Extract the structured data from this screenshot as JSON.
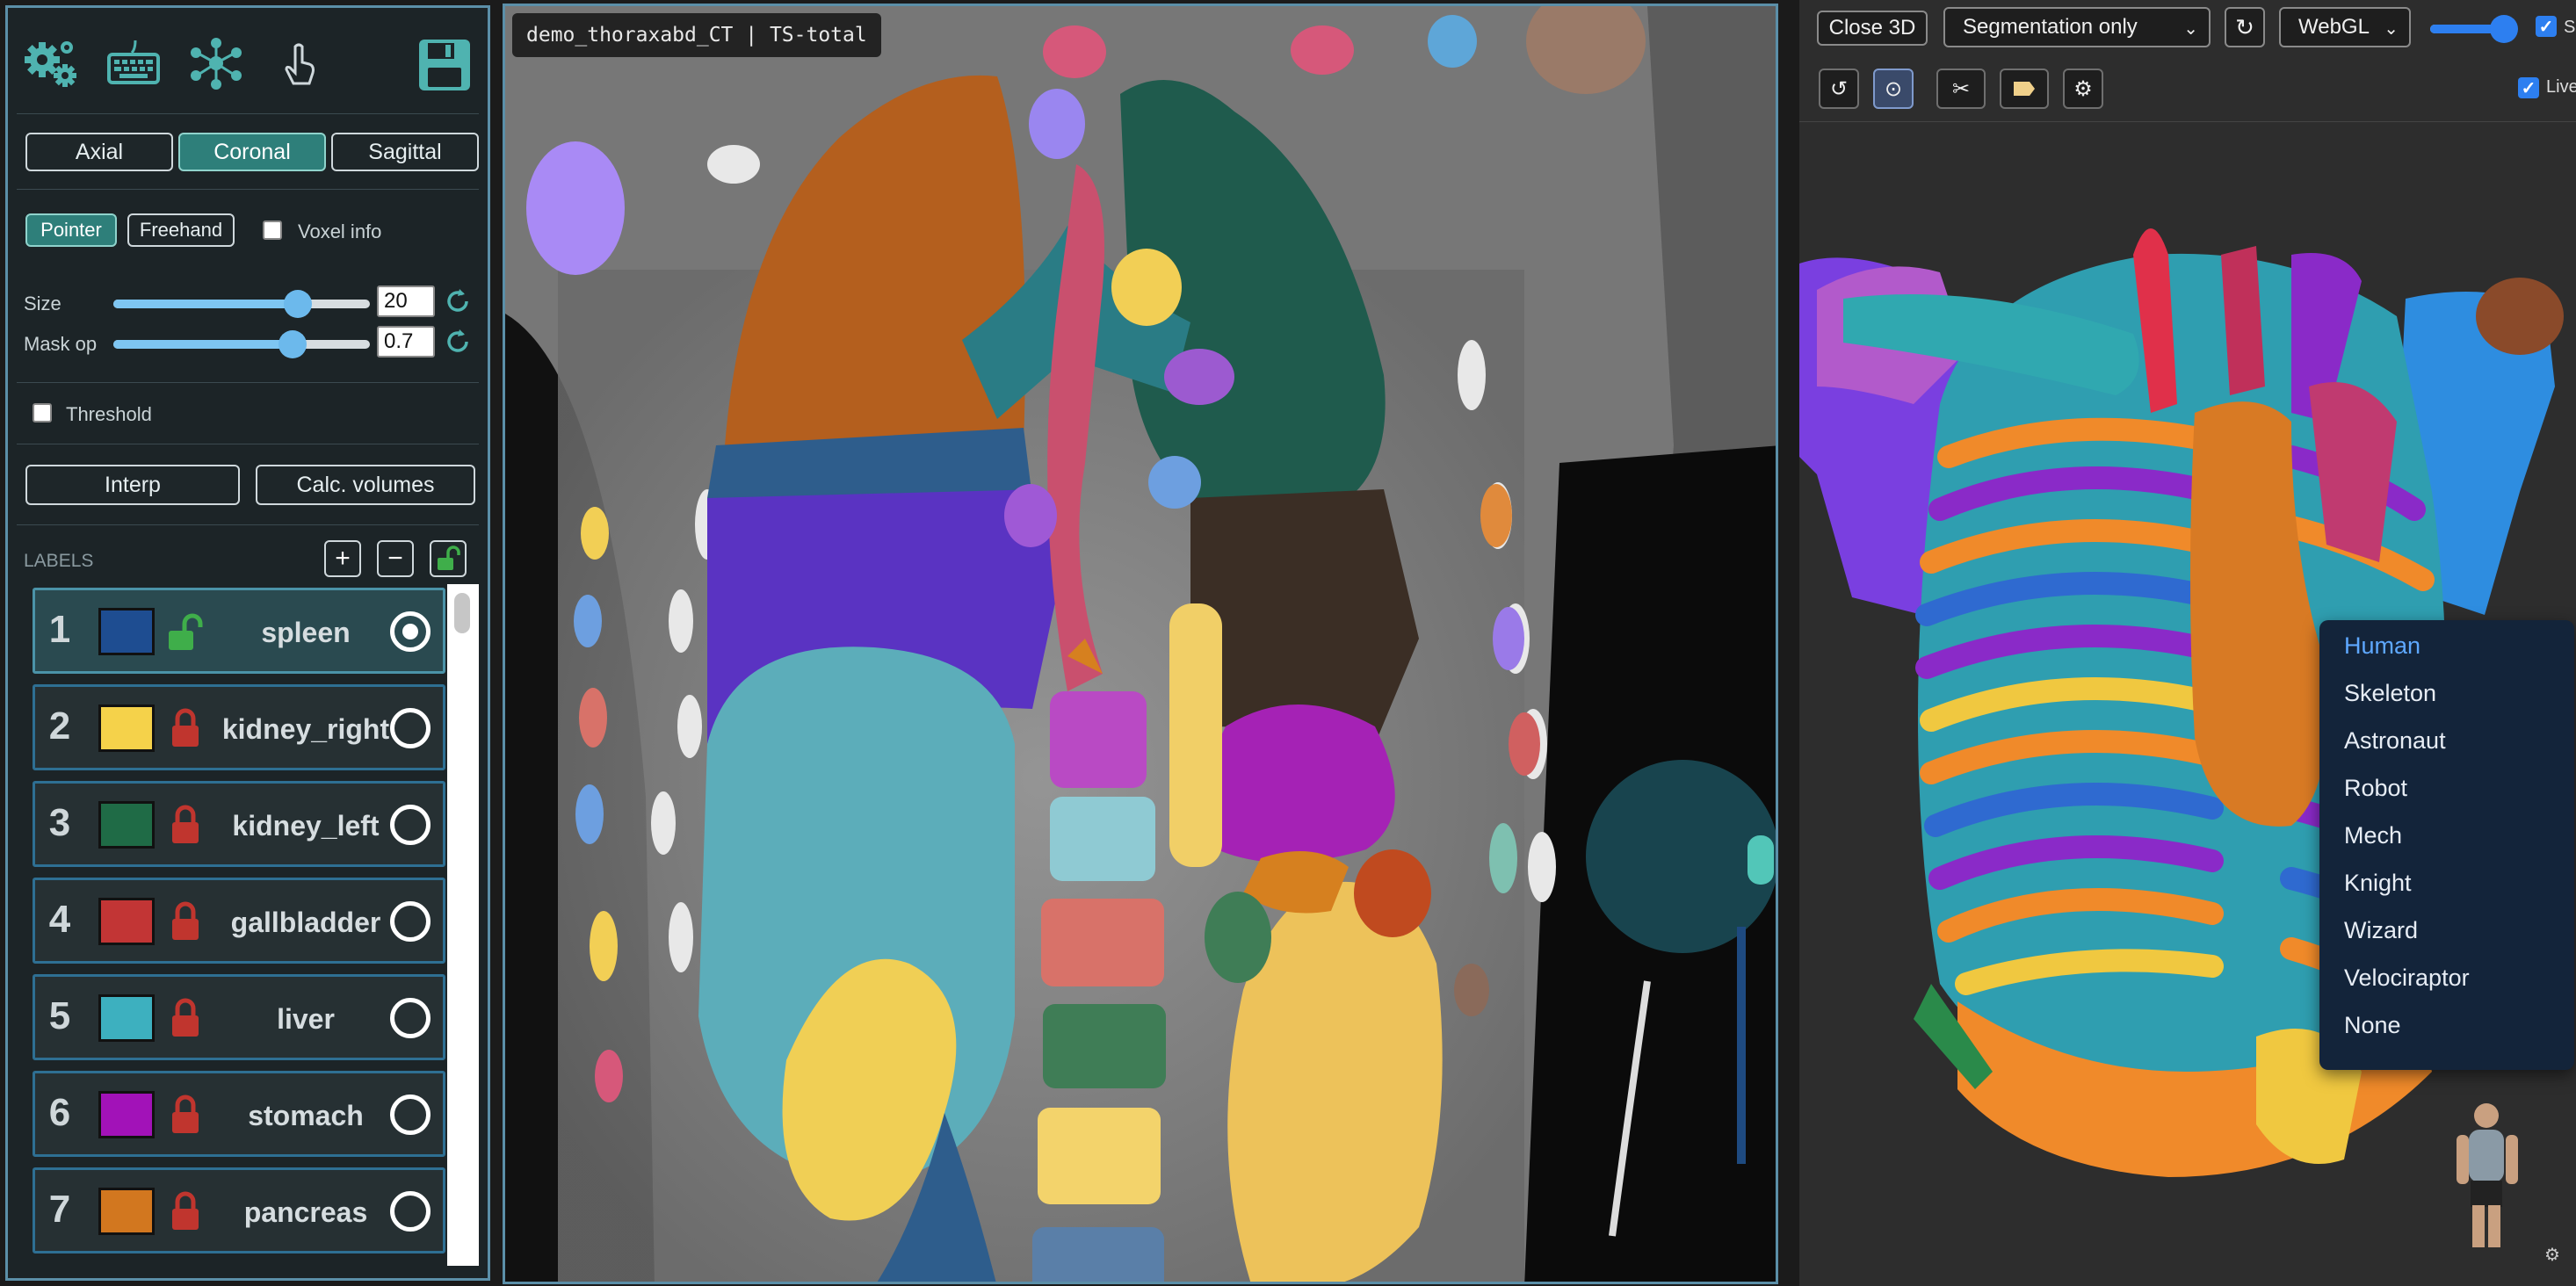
{
  "toolbar": {
    "icons": [
      "settings-gears-icon",
      "keyboard-icon",
      "network-icon",
      "pointer-hand-icon",
      "save-icon"
    ]
  },
  "views": {
    "axial": "Axial",
    "coronal": "Coronal",
    "sagittal": "Sagittal",
    "active": "Coronal"
  },
  "tools": {
    "pointer": "Pointer",
    "freehand": "Freehand",
    "voxel_info": "Voxel info"
  },
  "brush": {
    "size_label": "Size",
    "size_value": "20",
    "size_fraction": 0.72,
    "maskop_label": "Mask op",
    "maskop_value": "0.7",
    "maskop_fraction": 0.7
  },
  "threshold": {
    "label": "Threshold"
  },
  "actions": {
    "interp": "Interp",
    "calc_volumes": "Calc. volumes"
  },
  "labels": {
    "header": "LABELS",
    "add": "+",
    "remove": "−",
    "items": [
      {
        "num": "1",
        "name": "spleen",
        "color": "#1e4d91",
        "locked": false,
        "selected": true
      },
      {
        "num": "2",
        "name": "kidney_right",
        "color": "#f5d24a",
        "locked": true,
        "selected": false
      },
      {
        "num": "3",
        "name": "kidney_left",
        "color": "#1f6b46",
        "locked": true,
        "selected": false
      },
      {
        "num": "4",
        "name": "gallbladder",
        "color": "#c23535",
        "locked": true,
        "selected": false
      },
      {
        "num": "5",
        "name": "liver",
        "color": "#3db0bf",
        "locked": true,
        "selected": false
      },
      {
        "num": "6",
        "name": "stomach",
        "color": "#a212b8",
        "locked": true,
        "selected": false
      },
      {
        "num": "7",
        "name": "pancreas",
        "color": "#d2771f",
        "locked": true,
        "selected": false
      }
    ]
  },
  "viewer": {
    "filename": "demo_thoraxabd_CT | TS-total"
  },
  "right": {
    "close3d": "Close 3D",
    "mode": "Segmentation only",
    "renderer": "WebGL",
    "refresh_glyph": "↻",
    "opacity_fraction": 0.88,
    "shade_label": "Shade",
    "live_label": "Live",
    "tools": [
      "rotate-icon",
      "target-icon",
      "scissors-icon",
      "tag-icon",
      "gear-icon"
    ]
  },
  "model_menu": {
    "options": [
      "Human",
      "Skeleton",
      "Astronaut",
      "Robot",
      "Mech",
      "Knight",
      "Wizard",
      "Velociraptor",
      "None"
    ],
    "selected": "Human"
  },
  "colors": {
    "accent": "#2e7f7a",
    "panel_border": "#5b8fa8",
    "menu_bg": "#13243a",
    "menu_selected": "#5ea8ff"
  }
}
